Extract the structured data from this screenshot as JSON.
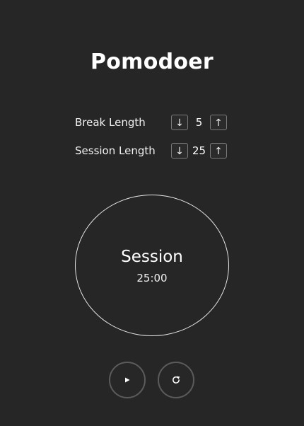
{
  "app": {
    "title": "Pomodoer"
  },
  "settings": {
    "break": {
      "label": "Break Length",
      "value": "5",
      "decrement_icon": "arrow-down-icon",
      "increment_icon": "arrow-up-icon",
      "decrement_glyph": "↓",
      "increment_glyph": "↑"
    },
    "session": {
      "label": "Session Length",
      "value": "25",
      "decrement_icon": "arrow-down-icon",
      "increment_icon": "arrow-up-icon",
      "decrement_glyph": "↓",
      "increment_glyph": "↑"
    }
  },
  "timer": {
    "label": "Session",
    "time": "25:00"
  },
  "controls": {
    "play_icon": "play-icon",
    "reset_icon": "reset-icon"
  },
  "colors": {
    "background": "#262626",
    "text": "#ffffff",
    "border": "#7a7a7a"
  }
}
